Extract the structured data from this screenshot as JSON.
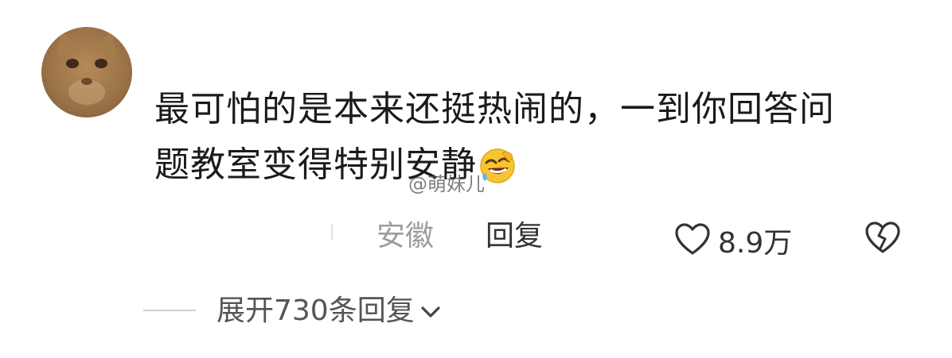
{
  "comment": {
    "text_line1": "最可怕的是本来还挺热闹的，一到你回答问",
    "text_line2": "题教室变得特别安静",
    "emoji": "laughing-face-icon"
  },
  "watermark": "@萌妹儿",
  "meta": {
    "location": "安徽",
    "reply_label": "回复",
    "like_count": "8.9万"
  },
  "replies": {
    "expand_label": "展开730条回复"
  }
}
